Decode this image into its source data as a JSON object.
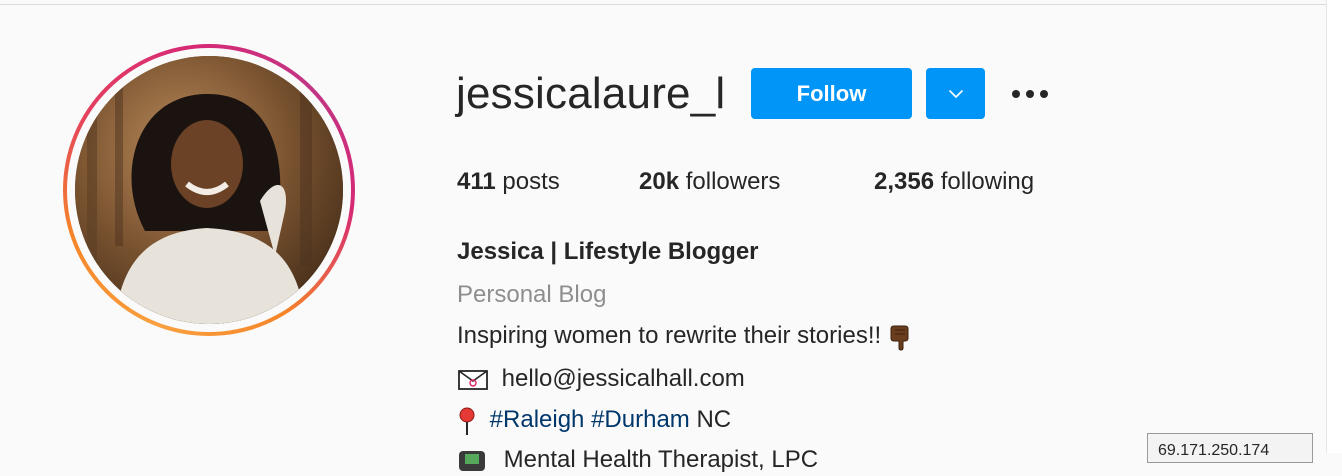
{
  "profile": {
    "username": "jessicalaure_l",
    "follow_label": "Follow",
    "stats": {
      "posts_count": "411",
      "posts_label": "posts",
      "followers_count": "20k",
      "followers_label": "followers",
      "following_count": "2,356",
      "following_label": "following"
    },
    "bio": {
      "name": "Jessica | Lifestyle Blogger",
      "category": "Personal Blog",
      "tagline": "Inspiring women to rewrite their stories!!",
      "email": "hello@jessicalhall.com",
      "hashtag_1": "#Raleigh",
      "hashtag_2": "#Durham",
      "location_suffix": "NC",
      "partial_line": "Mental Health Therapist, LPC"
    }
  },
  "tooltip": {
    "text": "69.171.250.174"
  },
  "icons": {
    "dropdown": "chevron-down-icon",
    "more": "more-options-icon",
    "tagline_emoji": "pointing-down-hand-icon",
    "email_emoji": "envelope-icon",
    "location_emoji": "pushpin-icon",
    "partial_emoji": "emoji-icon"
  },
  "colors": {
    "accent": "#0095f6",
    "hashtag": "#00376b",
    "muted": "#8e8e8e"
  }
}
